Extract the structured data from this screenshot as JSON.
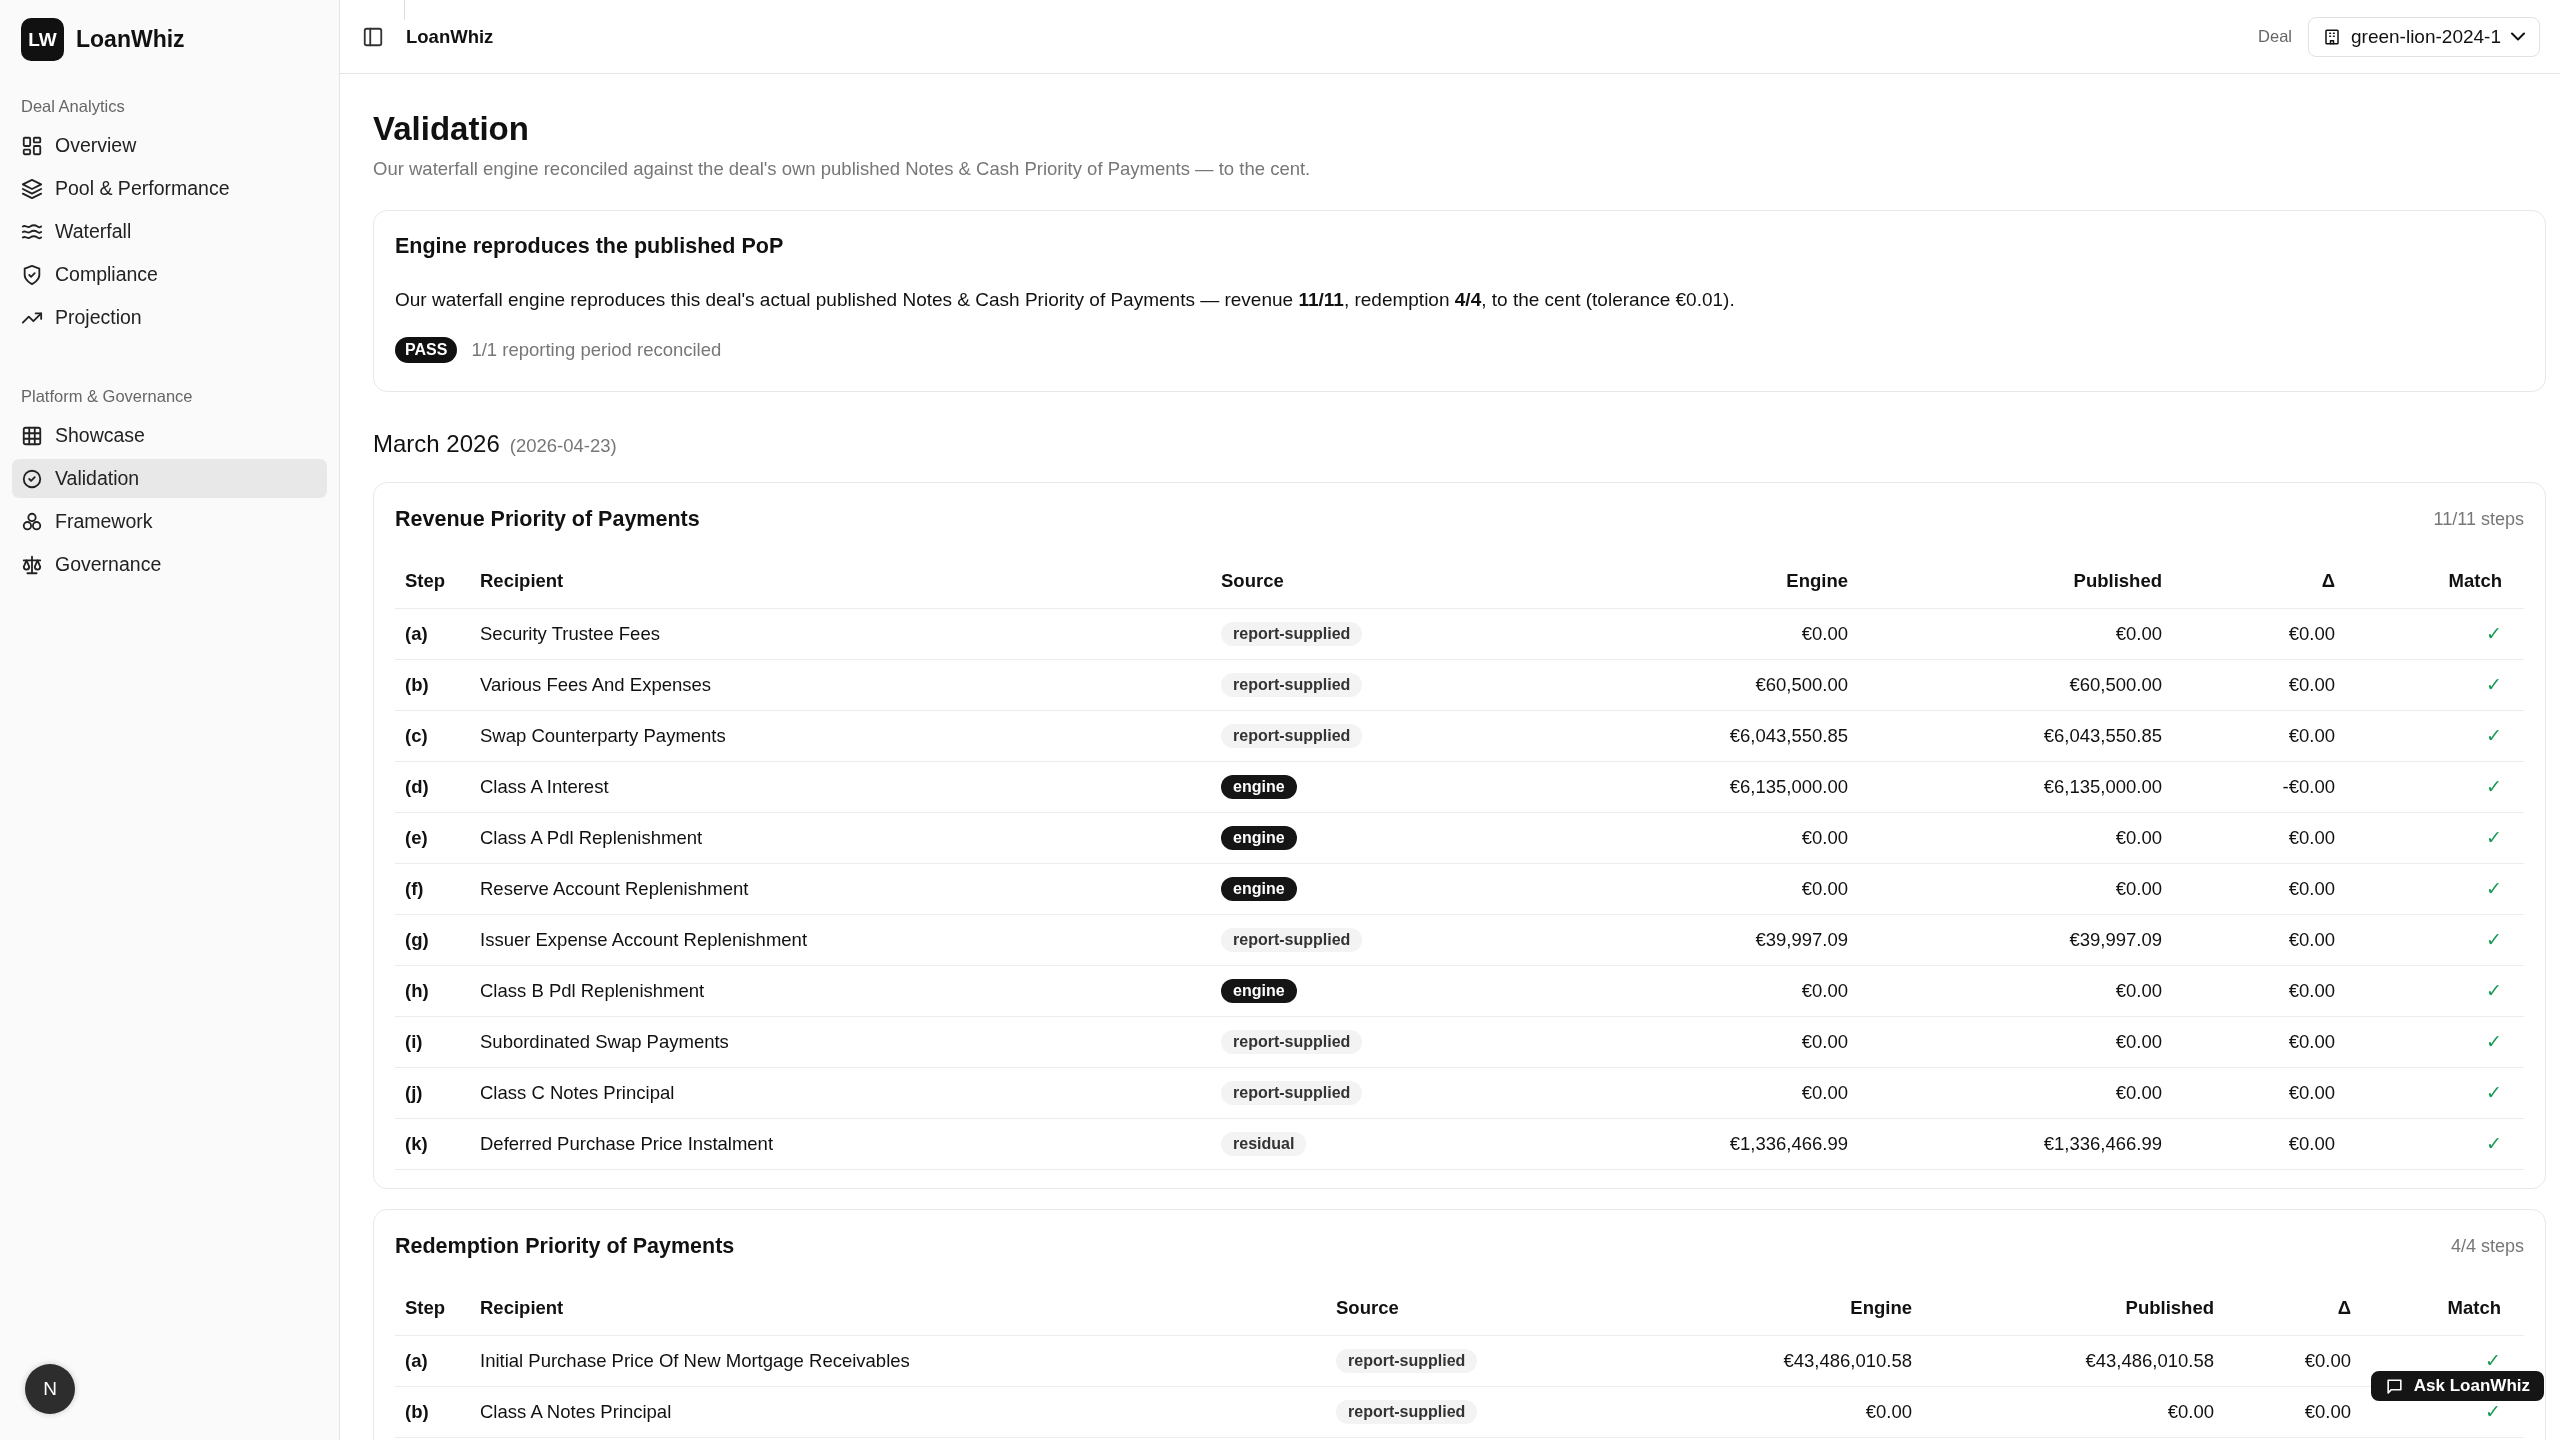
{
  "app": {
    "logo": "LW",
    "name": "LoanWhiz"
  },
  "sidebar": {
    "sections": [
      {
        "title": "Deal Analytics",
        "items": [
          {
            "label": "Overview",
            "selected": false
          },
          {
            "label": "Pool & Performance",
            "selected": false
          },
          {
            "label": "Waterfall",
            "selected": false
          },
          {
            "label": "Compliance",
            "selected": false
          },
          {
            "label": "Projection",
            "selected": false
          }
        ]
      },
      {
        "title": "Platform & Governance",
        "items": [
          {
            "label": "Showcase",
            "selected": false
          },
          {
            "label": "Validation",
            "selected": true
          },
          {
            "label": "Framework",
            "selected": false
          },
          {
            "label": "Governance",
            "selected": false
          }
        ]
      }
    ],
    "user_avatar": "N"
  },
  "header": {
    "breadcrumb": "LoanWhiz",
    "deal_label": "Deal",
    "deal_value": "green-lion-2024-1"
  },
  "page": {
    "title": "Validation",
    "subtitle": "Our waterfall engine reconciled against the deal's own published Notes & Cash Priority of Payments — to the cent."
  },
  "summary": {
    "title": "Engine reproduces the published PoP",
    "text": "Our waterfall engine reproduces this deal's actual published Notes & Cash Priority of Payments — revenue **11/11**, redemption **4/4**, to the cent (tolerance €0.01).",
    "badge": "PASS",
    "note": "1/1 reporting period reconciled"
  },
  "period": {
    "title": "March 2026",
    "date": "(2026-04-23)"
  },
  "tables": [
    {
      "title": "Revenue Priority of Payments",
      "count": "11/11 steps",
      "columns": [
        "Step",
        "Recipient",
        "Source",
        "Engine",
        "Published",
        "Δ",
        "Match"
      ],
      "rows": [
        {
          "step": "(a)",
          "recipient": "Security Trustee Fees",
          "source": "report-supplied",
          "source_emphasis": false,
          "engine": "€0.00",
          "published": "€0.00",
          "delta": "€0.00",
          "match": "✓"
        },
        {
          "step": "(b)",
          "recipient": "Various Fees And Expenses",
          "source": "report-supplied",
          "source_emphasis": false,
          "engine": "€60,500.00",
          "published": "€60,500.00",
          "delta": "€0.00",
          "match": "✓"
        },
        {
          "step": "(c)",
          "recipient": "Swap Counterparty Payments",
          "source": "report-supplied",
          "source_emphasis": false,
          "engine": "€6,043,550.85",
          "published": "€6,043,550.85",
          "delta": "€0.00",
          "match": "✓"
        },
        {
          "step": "(d)",
          "recipient": "Class A Interest",
          "source": "engine",
          "source_emphasis": true,
          "engine": "€6,135,000.00",
          "published": "€6,135,000.00",
          "delta": "-€0.00",
          "match": "✓"
        },
        {
          "step": "(e)",
          "recipient": "Class A Pdl Replenishment",
          "source": "engine",
          "source_emphasis": true,
          "engine": "€0.00",
          "published": "€0.00",
          "delta": "€0.00",
          "match": "✓"
        },
        {
          "step": "(f)",
          "recipient": "Reserve Account Replenishment",
          "source": "engine",
          "source_emphasis": true,
          "engine": "€0.00",
          "published": "€0.00",
          "delta": "€0.00",
          "match": "✓"
        },
        {
          "step": "(g)",
          "recipient": "Issuer Expense Account Replenishment",
          "source": "report-supplied",
          "source_emphasis": false,
          "engine": "€39,997.09",
          "published": "€39,997.09",
          "delta": "€0.00",
          "match": "✓"
        },
        {
          "step": "(h)",
          "recipient": "Class B Pdl Replenishment",
          "source": "engine",
          "source_emphasis": true,
          "engine": "€0.00",
          "published": "€0.00",
          "delta": "€0.00",
          "match": "✓"
        },
        {
          "step": "(i)",
          "recipient": "Subordinated Swap Payments",
          "source": "report-supplied",
          "source_emphasis": false,
          "engine": "€0.00",
          "published": "€0.00",
          "delta": "€0.00",
          "match": "✓"
        },
        {
          "step": "(j)",
          "recipient": "Class C Notes Principal",
          "source": "report-supplied",
          "source_emphasis": false,
          "engine": "€0.00",
          "published": "€0.00",
          "delta": "€0.00",
          "match": "✓"
        },
        {
          "step": "(k)",
          "recipient": "Deferred Purchase Price Instalment",
          "source": "residual",
          "source_emphasis": false,
          "engine": "€1,336,466.99",
          "published": "€1,336,466.99",
          "delta": "€0.00",
          "match": "✓"
        }
      ]
    },
    {
      "title": "Redemption Priority of Payments",
      "count": "4/4 steps",
      "columns": [
        "Step",
        "Recipient",
        "Source",
        "Engine",
        "Published",
        "Δ",
        "Match"
      ],
      "rows": [
        {
          "step": "(a)",
          "recipient": "Initial Purchase Price Of New Mortgage Receivables",
          "source": "report-supplied",
          "source_emphasis": false,
          "engine": "€43,486,010.58",
          "published": "€43,486,010.58",
          "delta": "€0.00",
          "match": "✓"
        },
        {
          "step": "(b)",
          "recipient": "Class A Notes Principal",
          "source": "report-supplied",
          "source_emphasis": false,
          "engine": "€0.00",
          "published": "€0.00",
          "delta": "€0.00",
          "match": "✓"
        }
      ]
    }
  ],
  "assistant_button": "Ask LoanWhiz"
}
